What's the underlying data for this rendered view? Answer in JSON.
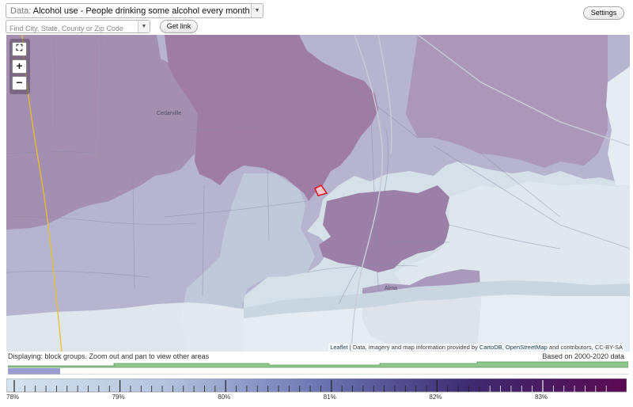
{
  "toolbar": {
    "data_label": "Data:",
    "data_value": "Alcohol use - People drinking some alcohol every month (%)",
    "search_placeholder": "Find City, State, County or Zip Code",
    "get_link": "Get link",
    "settings": "Settings"
  },
  "map": {
    "zoom_in": "+",
    "zoom_out": "−",
    "full_extent": "⛶",
    "place_labels": [
      "Cedarville",
      "Alma"
    ],
    "attribution": {
      "leaflet": "Leaflet",
      "text_1": " | Data, imagery and map information provided by ",
      "cartodb": "CartoDB",
      "text_2": ", ",
      "osm": "OpenStreetMap",
      "text_3": " and contributors, CC-BY-SA"
    },
    "colors": {
      "low": "#d3dde6",
      "mid": "#b7b7cf",
      "high": "#96739a",
      "highlight": "#e0192a",
      "road": "#e6c12a"
    }
  },
  "status": {
    "displaying": "Displaying: block groups. Zoom out and pan to view other areas",
    "based_on": "Based on 2000-2020 data"
  },
  "legend": {
    "tick_labels": [
      "78%",
      "79%",
      "80%",
      "81%",
      "82%",
      "83%"
    ],
    "gradient": [
      "#d6e4ef",
      "#9fb2d4",
      "#5c5796",
      "#3b1a5e",
      "#5a0a50"
    ],
    "histogram_color": "#8fc78c",
    "selected_color": "#9a9dd0"
  }
}
